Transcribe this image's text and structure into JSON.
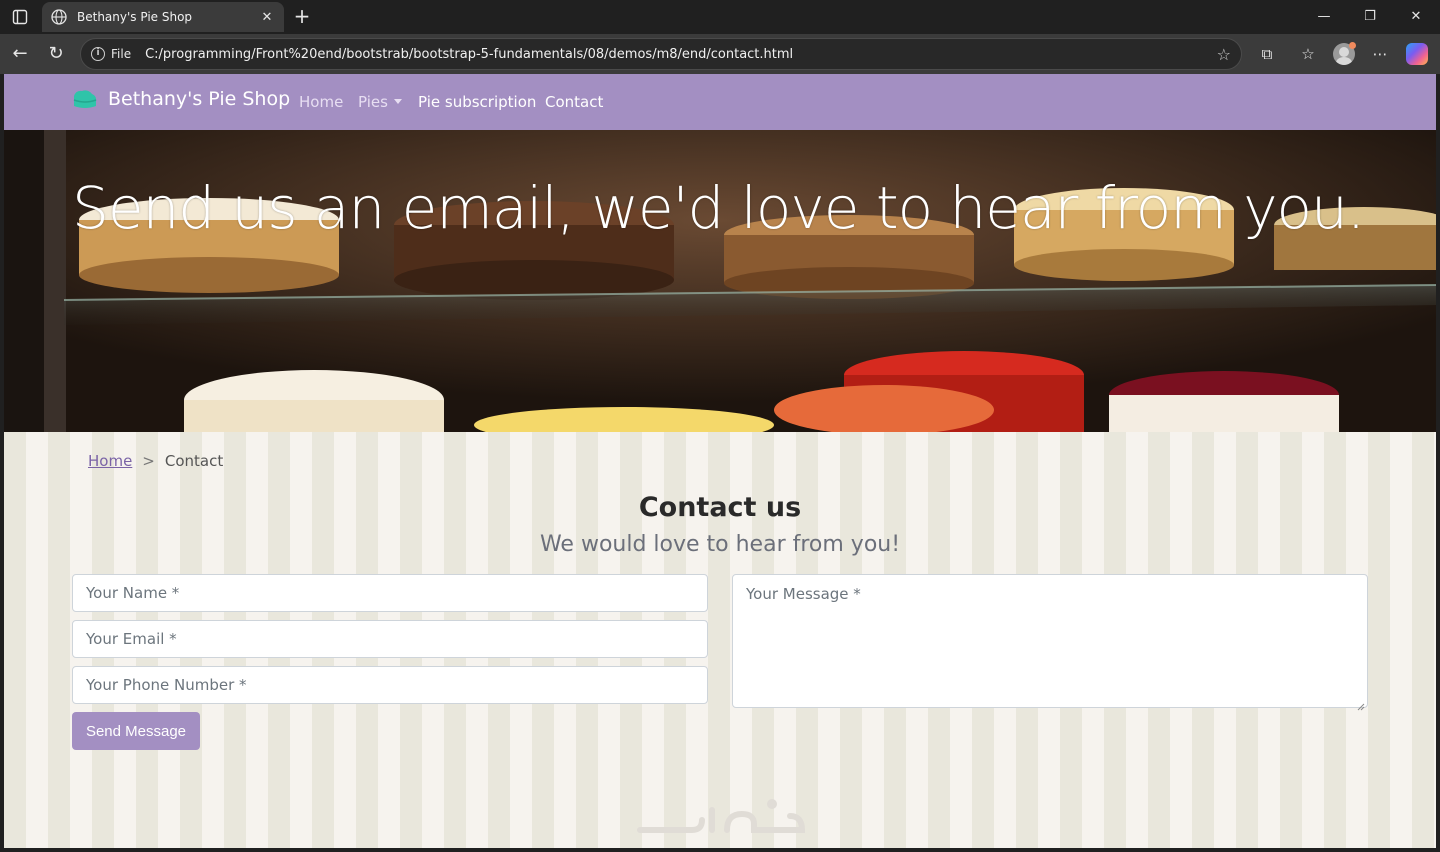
{
  "browser": {
    "tab_title": "Bethany's Pie Shop",
    "scheme_label": "File",
    "url": "C:/programming/Front%20end/bootstrab/bootstrap-5-fundamentals/08/demos/m8/end/contact.html"
  },
  "navbar": {
    "brand": "Bethany's Pie Shop",
    "links": [
      {
        "label": "Home"
      },
      {
        "label": "Pies"
      },
      {
        "label": "Pie subscription"
      },
      {
        "label": "Contact"
      }
    ]
  },
  "hero": {
    "title": "Send us an email, we'd love to hear from you."
  },
  "breadcrumb": {
    "home": "Home",
    "separator": ">",
    "current": "Contact"
  },
  "contact": {
    "title": "Contact us",
    "subtitle": "We would love to hear from you!",
    "name_placeholder": "Your Name *",
    "email_placeholder": "Your Email *",
    "phone_placeholder": "Your Phone Number *",
    "message_placeholder": "Your Message *",
    "submit_label": "Send Message"
  },
  "colors": {
    "navbar": "#a38fc2",
    "button": "#a38fc2",
    "link": "#7a63a6"
  }
}
